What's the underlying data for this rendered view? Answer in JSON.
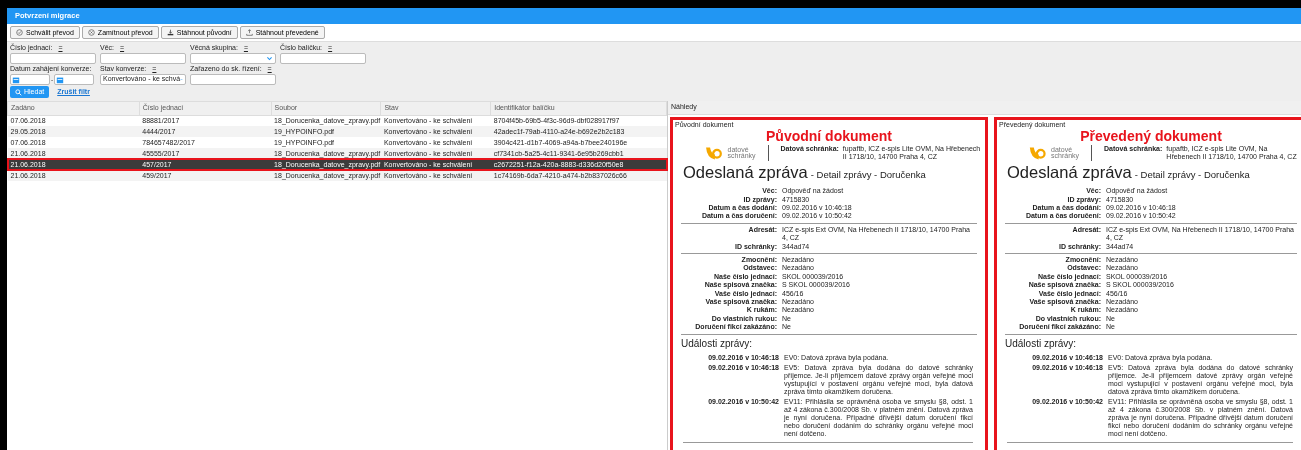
{
  "window": {
    "title": "Potvrzení migrace"
  },
  "toolbar": [
    {
      "label": "Schválit převod"
    },
    {
      "label": "Zamítnout převod"
    },
    {
      "label": "Stáhnout původní"
    },
    {
      "label": "Stáhnout převedené"
    }
  ],
  "filters": [
    [
      {
        "label": "Číslo jednací:",
        "operator": "=",
        "kind": "text"
      },
      {
        "label": "Věc:",
        "operator": "=",
        "kind": "text"
      },
      {
        "label": "Věcná skupina:",
        "operator": "=",
        "kind": "select"
      },
      {
        "label": "Číslo balíčku:",
        "operator": "=",
        "kind": "text"
      }
    ],
    [
      {
        "label": "Datum zahájení konverze:",
        "kind": "daterange",
        "separator": "-"
      },
      {
        "label": "Stav konverze:",
        "operator": "=",
        "kind": "select",
        "value": "Konvertováno - ke schvá"
      },
      {
        "label": "Zařazeno do sk. řízení:",
        "operator": "=",
        "kind": "text"
      }
    ]
  ],
  "search_button": "Hledat",
  "clear_link": "Zrušit filtr",
  "table": {
    "columns": [
      "Zadáno",
      "Číslo jednací",
      "Soubor",
      "Stav",
      "Identifikátor balíčku"
    ],
    "rows": [
      {
        "cells": [
          "07.06.2018",
          "88881/2017",
          "18_Dorucenka_datove_zpravy.pdf",
          "Konvertováno - ke schválení",
          "8704f45b-69b5-4f3c-96d9-dbf028917f97"
        ],
        "selected": false
      },
      {
        "cells": [
          "29.05.2018",
          "4444/2017",
          "19_HYPOINFO.pdf",
          "Konvertováno - ke schválení",
          "42adec1f-79ab-4110-a24e-b692e2b2c183"
        ],
        "selected": false
      },
      {
        "cells": [
          "07.06.2018",
          "784657482/2017",
          "19_HYPOINFO.pdf",
          "Konvertováno - ke schválení",
          "3904c421-d1b7-4069-a94a-b7bee240196e"
        ],
        "selected": false
      },
      {
        "cells": [
          "21.06.2018",
          "45555/2017",
          "18_Dorucenka_datove_zpravy.pdf",
          "Konvertováno - ke schválení",
          "cf7341cb-5a25-4c11-9341-6e95b269cbb1"
        ],
        "selected": false
      },
      {
        "cells": [
          "21.06.2018",
          "457/2017",
          "18_Dorucenka_datove_zpravy.pdf",
          "Konvertováno - ke schválení",
          "c2672251-f12a-420a-8883-d336d20f50e8"
        ],
        "selected": true
      },
      {
        "cells": [
          "21.06.2018",
          "459/2017",
          "18_Dorucenka_datove_zpravy.pdf",
          "Konvertováno - ke schválení",
          "1c74169b-6da7-4210-a474-b2b837026c66"
        ],
        "selected": false
      }
    ]
  },
  "preview": {
    "title": "Náhledy",
    "documents": [
      {
        "caption": "Původní dokument",
        "annotation": "Původní dokument",
        "logo_line1": "datové",
        "logo_line2": "schránky",
        "box_label": "Datová schránka:",
        "box_value": "fupaftb, ICZ e-spis Lite OVM, Na Hřebenech II 1718/10, 14700 Praha 4, CZ",
        "heading": "Odeslaná zpráva",
        "subheading": "- Detail zprávy - Doručenka",
        "sections": [
          [
            [
              "Věc:",
              "Odpověď na žádost"
            ],
            [
              "ID zprávy:",
              "4715830"
            ],
            [
              "Datum a čas dodání:",
              "09.02.2016 v 10:46:18"
            ],
            [
              "Datum a čas doručení:",
              "09.02.2016 v 10:50:42"
            ]
          ],
          [
            [
              "Adresát:",
              "ICZ e-spis Ext OVM, Na Hřebenech II 1718/10, 14700 Praha 4, CZ"
            ],
            [
              "ID schránky:",
              "344ad74"
            ]
          ],
          [
            [
              "Zmocnění:",
              "Nezadáno"
            ],
            [
              "Odstavec:",
              "Nezadáno"
            ],
            [
              "Naše číslo jednací:",
              "SKOL 000039/2016"
            ],
            [
              "Naše spisová značka:",
              "S SKOL 000039/2016"
            ],
            [
              "Vaše číslo jednací:",
              "456/16"
            ],
            [
              "Vaše spisová značka:",
              "Nezadáno"
            ],
            [
              "K rukám:",
              "Nezadáno"
            ],
            [
              "Do vlastních rukou:",
              "Ne"
            ],
            [
              "Doručení fikcí zakázáno:",
              "Ne"
            ]
          ]
        ],
        "events_title": "Události zprávy:",
        "events": [
          [
            "09.02.2016 v 10:46:18",
            "EV0: Datová zpráva byla podána."
          ],
          [
            "09.02.2016 v 10:46:18",
            "EV5: Datová zpráva byla dodána do datové schránky příjemce. Je-li příjemcem datové zprávy orgán veřejné moci vystupující v postavení orgánu veřejné moci, byla datová zpráva tímto okamžikem doručena."
          ],
          [
            "09.02.2016 v 10:50:42",
            "EV11: Přihlásila se oprávněná osoba ve smyslu §8, odst. 1 až 4 zákona č.300/2008 Sb. v platném znění. Datová zpráva je nyní doručena. Případné dřívější datum doručení fikcí nebo doručení dodáním do schránky orgánu veřejné moci není dotčeno."
          ]
        ]
      },
      {
        "caption": "Převedený dokument",
        "annotation": "Převedený dokument",
        "logo_line1": "datové",
        "logo_line2": "schránky",
        "box_label": "Datová schránka:",
        "box_value": "fupaftb, ICZ e-spis Lite OVM, Na Hřebenech II 1718/10, 14700 Praha 4, CZ",
        "heading": "Odeslaná zpráva",
        "subheading": "- Detail zprávy - Doručenka",
        "sections": [
          [
            [
              "Věc:",
              "Odpověď na žádost"
            ],
            [
              "ID zprávy:",
              "4715830"
            ],
            [
              "Datum a čas dodání:",
              "09.02.2016 v 10:46:18"
            ],
            [
              "Datum a čas doručení:",
              "09.02.2016 v 10:50:42"
            ]
          ],
          [
            [
              "Adresát:",
              "ICZ e-spis Ext OVM, Na Hřebenech II 1718/10, 14700 Praha 4, CZ"
            ],
            [
              "ID schránky:",
              "344ad74"
            ]
          ],
          [
            [
              "Zmocnění:",
              "Nezadáno"
            ],
            [
              "Odstavec:",
              "Nezadáno"
            ],
            [
              "Naše číslo jednací:",
              "SKOL 000039/2016"
            ],
            [
              "Naše spisová značka:",
              "S SKOL 000039/2016"
            ],
            [
              "Vaše číslo jednací:",
              "456/16"
            ],
            [
              "Vaše spisová značka:",
              "Nezadáno"
            ],
            [
              "K rukám:",
              "Nezadáno"
            ],
            [
              "Do vlastních rukou:",
              "Ne"
            ],
            [
              "Doručení fikcí zakázáno:",
              "Ne"
            ]
          ]
        ],
        "events_title": "Události zprávy:",
        "events": [
          [
            "09.02.2016 v 10:46:18",
            "EV0: Datová zpráva byla podána."
          ],
          [
            "09.02.2016 v 10:46:18",
            "EV5: Datová zpráva byla dodána do datové schránky příjemce. Je-li příjemcem datové zprávy orgán veřejné moci vystupující v postavení orgánu veřejné moci, byla datová zpráva tímto okamžikem doručena."
          ],
          [
            "09.02.2016 v 10:50:42",
            "EV11: Přihlásila se oprávněná osoba ve smyslu §8, odst. 1 až 4 zákona č.300/2008 Sb. v platném znění. Datová zpráva je nyní doručena. Případné dřívější datum doručení fikcí nebo doručení dodáním do schránky orgánu veřejné moci není dotčeno."
          ]
        ]
      }
    ]
  }
}
